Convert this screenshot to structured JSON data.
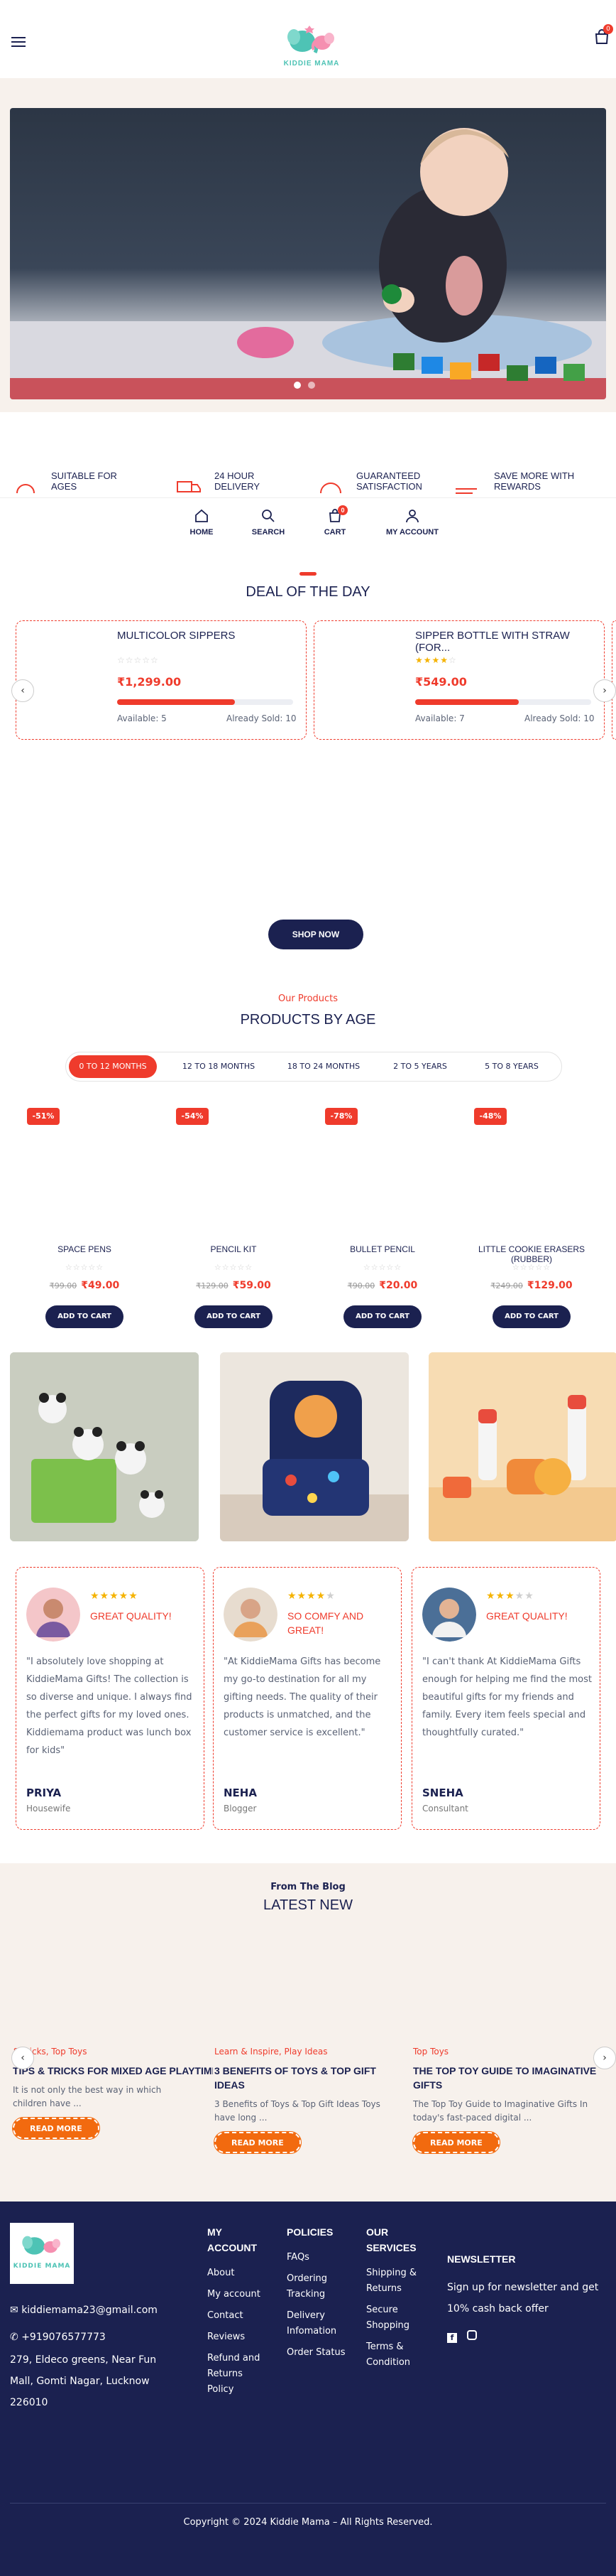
{
  "header": {
    "logo_text": "KIDDIE MAMA",
    "cart_count": "0"
  },
  "features": [
    {
      "label": "SUITABLE FOR AGES",
      "icon": "ages-icon"
    },
    {
      "label": "24 HOUR DELIVERY",
      "icon": "delivery-truck-icon"
    },
    {
      "label": "GUARANTEED SATISFACTION",
      "icon": "satisfaction-icon"
    },
    {
      "label": "SAVE MORE WITH REWARDS",
      "icon": "rewards-icon"
    }
  ],
  "bottom_nav": [
    {
      "label": "HOME",
      "icon": "home-icon"
    },
    {
      "label": "SEARCH",
      "icon": "search-icon"
    },
    {
      "label": "CART",
      "icon": "cart-icon",
      "badge": "0"
    },
    {
      "label": "MY ACCOUNT",
      "icon": "user-icon"
    }
  ],
  "deal": {
    "title": "DEAL OF THE DAY",
    "items": [
      {
        "name": "MULTICOLOR SIPPERS",
        "rating": 0,
        "price": "₹1,299.00",
        "available": "Available: 5",
        "sold": "Already Sold: 10",
        "sold_fraction": 0.67
      },
      {
        "name": "SIPPER BOTTLE WITH STRAW (FOR...",
        "rating": 4,
        "price": "₹549.00",
        "available": "Available: 7",
        "sold": "Already Sold: 10",
        "sold_fraction": 0.59
      }
    ],
    "shop_now": "SHOP NOW"
  },
  "products": {
    "eyebrow": "Our Products",
    "title": "PRODUCTS BY AGE",
    "tabs": [
      "0 TO 12 MONTHS",
      "12 TO 18 MONTHS",
      "18 TO 24 MONTHS",
      "2 TO 5 YEARS",
      "5 TO 8 YEARS"
    ],
    "active_tab": 0,
    "items": [
      {
        "discount": "-51%",
        "name": "SPACE PENS",
        "old_price": "₹99.00",
        "price": "₹49.00",
        "button": "ADD TO CART"
      },
      {
        "discount": "-54%",
        "name": "PENCIL KIT",
        "old_price": "₹129.00",
        "price": "₹59.00",
        "button": "ADD TO CART"
      },
      {
        "discount": "-78%",
        "name": "BULLET PENCIL",
        "old_price": "₹90.00",
        "price": "₹20.00",
        "button": "ADD TO CART"
      },
      {
        "discount": "-48%",
        "name": "LITTLE COOKIE ERASERS (RUBBER)",
        "old_price": "₹249.00",
        "price": "₹129.00",
        "button": "ADD TO CART"
      }
    ]
  },
  "testimonials": [
    {
      "stars": 5,
      "title": "GREAT QUALITY!",
      "quote": "\"I absolutely love shopping at KiddieMama Gifts! The collection is so diverse and unique. I always find the perfect gifts for my loved ones. Kiddiemama product was lunch box for kids\"",
      "name": "PRIYA",
      "role": "Housewife"
    },
    {
      "stars": 4,
      "title": "SO COMFY AND GREAT!",
      "quote": "\"At KiddieMama Gifts has become my go-to destination for all my gifting needs. The quality of their products is unmatched, and the customer service is excellent.\"",
      "name": "NEHA",
      "role": "Blogger"
    },
    {
      "stars": 3,
      "title": "GREAT QUALITY!",
      "quote": "\"I can't thank At KiddieMama Gifts enough for helping me find the most beautiful gifts for my friends and family. Every item feels special and thoughtfully curated.\"",
      "name": "SNEHA",
      "role": "Consultant"
    }
  ],
  "blog": {
    "eyebrow": "From The Blog",
    "title": "LATEST NEW",
    "posts": [
      {
        "category": "& Tricks, Top Toys",
        "title": "TIPS & TRICKS FOR MIXED AGE PLAYTIME",
        "excerpt": "It is not only the best way in which children have ...",
        "button": "READ MORE"
      },
      {
        "category": "Learn & Inspire, Play Ideas",
        "title": "3 BENEFITS OF TOYS & TOP GIFT IDEAS",
        "excerpt": "3 Benefits of Toys & Top Gift Ideas Toys have long ...",
        "button": "READ MORE"
      },
      {
        "category": "Top Toys",
        "title": "THE TOP TOY GUIDE TO IMAGINATIVE GIFTS",
        "excerpt": "The Top Toy Guide to Imaginative Gifts In today's fast-paced digital ...",
        "button": "READ MORE"
      }
    ]
  },
  "footer": {
    "logo_text": "KIDDIE MAMA",
    "email": "kiddiemama23@gmail.com",
    "phone": "+919076577773",
    "address": "279, Eldeco greens, Near Fun Mall, Gomti Nagar, Lucknow 226010",
    "my_account": {
      "title": "MY ACCOUNT",
      "links": [
        "About",
        "My account",
        "Contact",
        "Reviews",
        "Refund and Returns Policy"
      ]
    },
    "policies": {
      "title": "POLICIES",
      "links": [
        "FAQs",
        "Ordering Tracking",
        "Delivery Infomation",
        "Order Status"
      ]
    },
    "services": {
      "title": "OUR SERVICES",
      "links": [
        "Shipping & Returns",
        "Secure Shopping",
        "Terms & Condition"
      ]
    },
    "newsletter": {
      "title": "NEWSLETTER",
      "text": "Sign up for newsletter and get 10% cash back offer"
    },
    "copyright": "Copyright © 2024 Kiddie Mama – All Rights Reserved."
  },
  "colors": {
    "accent": "#ef3b2c",
    "navy": "#1b2150",
    "orange": "#f26a0f",
    "cream": "#f7f1ec"
  }
}
